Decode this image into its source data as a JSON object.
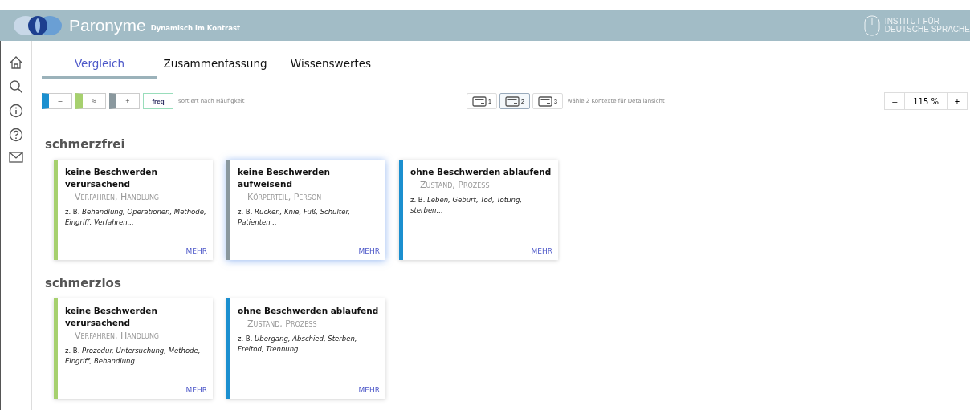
{
  "header": {
    "title": "Paronyme",
    "subtitle": "Dynamisch im Kontrast",
    "institute": [
      "INSTITUT FÜR",
      "DEUTSCHE SPRACHE"
    ]
  },
  "tabs": [
    {
      "label": "Vergleich",
      "selected": true
    },
    {
      "label": "Zusammenfassung",
      "selected": false
    },
    {
      "label": "Wissenswertes",
      "selected": false
    }
  ],
  "filters": [
    {
      "label": "–",
      "color": "#1b8fcf"
    },
    {
      "label": "≈",
      "color": "#a6d06e"
    },
    {
      "label": "+",
      "color": "#8a989e"
    }
  ],
  "freq_button": "freq",
  "sort_note": "sortiert nach Häufigkeit",
  "contexts": [
    {
      "label": "1",
      "selected": false
    },
    {
      "label": "2",
      "selected": true
    },
    {
      "label": "3",
      "selected": false
    }
  ],
  "context_note": "wähle 2 Kontexte für Detailansicht",
  "zoom": {
    "minus": "–",
    "value": "115 %",
    "plus": "+"
  },
  "groups": [
    {
      "word": "schmerzfrei",
      "cards": [
        {
          "title": "keine Beschwerden verursachend",
          "category": "Verfahren, Handlung",
          "examples": "z. B. *Behandlung, Operationen, Methode, Eingriff, Verfahren...*",
          "more": "MEHR",
          "color": "#a6d06e",
          "selected": false
        },
        {
          "title": "keine Beschwerden aufweisend",
          "category": "Körperteil, Person",
          "examples": "z. B. *Rücken, Knie, Fuß, Schulter, Patienten...*",
          "more": "MEHR",
          "color": "#8a989e",
          "selected": true
        },
        {
          "title": "ohne Beschwerden ablaufend",
          "category": "Zustand, Prozess",
          "examples": "z. B. *Leben, Geburt, Tod, Tötung, sterben...*",
          "more": "MEHR",
          "color": "#1b8fcf",
          "selected": false
        }
      ]
    },
    {
      "word": "schmerzlos",
      "cards": [
        {
          "title": "keine Beschwerden verursachend",
          "category": "Verfahren, Handlung",
          "examples": "z. B. *Prozedur, Untersuchung, Methode, Eingriff, Behandlung...*",
          "more": "MEHR",
          "color": "#a6d06e",
          "selected": false
        },
        {
          "title": "ohne Beschwerden ablaufend",
          "category": "Zustand, Prozess",
          "examples": "z. B. *Übergang, Abschied, Sterben, Freitod, Trennung...*",
          "more": "MEHR",
          "color": "#1b8fcf",
          "selected": false
        }
      ]
    }
  ]
}
